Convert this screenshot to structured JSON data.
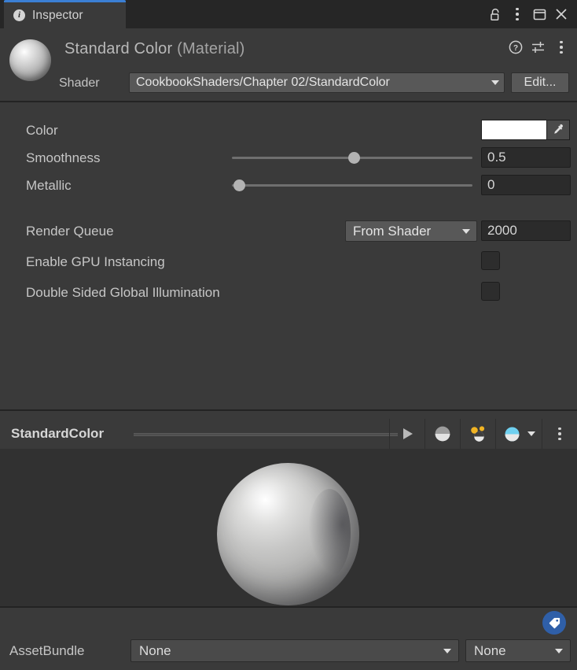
{
  "window": {
    "tab_label": "Inspector",
    "tab_icon": "info-icon",
    "controls": {
      "lock": "lock-open-icon",
      "menu": "kebab-menu-icon",
      "maximize": "maximize-icon",
      "close": "close-icon"
    }
  },
  "material_header": {
    "thumbnail": "material-sphere-thumbnail",
    "name": "Standard Color",
    "type": " (Material)",
    "icons": {
      "help": "help-icon",
      "preset": "preset-sliders-icon",
      "menu": "kebab-menu-icon"
    },
    "shader_label": "Shader",
    "shader_value": "CookbookShaders/Chapter 02/StandardColor",
    "edit_button": "Edit..."
  },
  "properties": [
    {
      "label": "Color",
      "control": "color",
      "color_value": "#ffffff",
      "eyedropper": "eyedropper-icon"
    },
    {
      "label": "Smoothness",
      "control": "slider",
      "value": "0.5",
      "slider_fraction": 0.505
    },
    {
      "label": "Metallic",
      "control": "slider",
      "value": "0",
      "slider_fraction": 0.03
    },
    {
      "label": "Render Queue",
      "control": "dropdown-number",
      "dropdown_value": "From Shader",
      "value": "2000"
    },
    {
      "label": "Enable GPU Instancing",
      "control": "checkbox",
      "checked": false
    },
    {
      "label": "Double Sided Global Illumination",
      "control": "checkbox",
      "checked": false
    }
  ],
  "preview": {
    "title": "StandardColor",
    "tools": {
      "play": "play-icon",
      "sphere": "preview-sphere-icon",
      "lighting": "lighting-icon",
      "material_preview": "material-preview-icon",
      "dropdown": "chevron-down-icon",
      "menu": "kebab-menu-icon"
    }
  },
  "bottom": {
    "tag_button": "asset-label-tag-icon",
    "assetbundle_label": "AssetBundle",
    "assetbundle_value": "None",
    "variant_value": "None"
  },
  "colors": {
    "panel_bg": "#3a3a3a",
    "titlebar_bg": "#262626",
    "preview_bg": "#313131",
    "accent_tab": "#3b7fd4",
    "field_bg": "#2b2b2b",
    "dropdown_bg": "#585858",
    "tag_blue": "#2f5fa8"
  }
}
